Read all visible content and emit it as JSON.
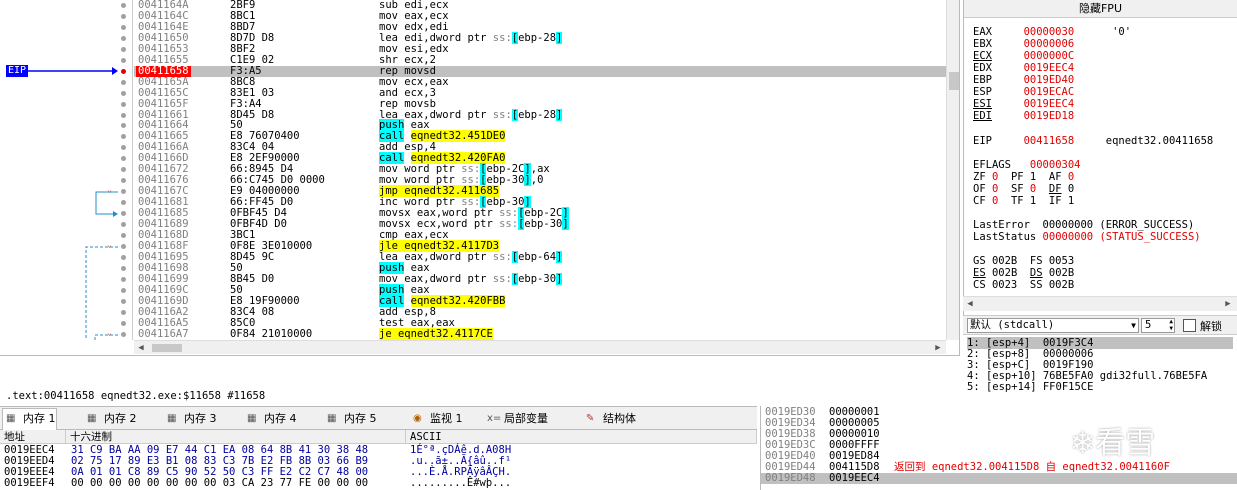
{
  "disasm_rows": [
    {
      "addr": "0041164A",
      "bytes": "2BF9",
      "instr": "sub edi,ecx"
    },
    {
      "addr": "0041164C",
      "bytes": "8BC1",
      "instr": "mov eax,ecx"
    },
    {
      "addr": "0041164E",
      "bytes": "8BD7",
      "instr": "mov edx,edi"
    },
    {
      "addr": "00411650",
      "bytes": "8D7D D8",
      "instr": "lea edi,dword ptr ss:[ebp-28]"
    },
    {
      "addr": "00411653",
      "bytes": "8BF2",
      "instr": "mov esi,edx"
    },
    {
      "addr": "00411655",
      "bytes": "C1E9 02",
      "instr": "shr ecx,2"
    },
    {
      "addr": "00411658",
      "bytes": "F3:A5",
      "instr": "rep movsd"
    },
    {
      "addr": "0041165A",
      "bytes": "8BC8",
      "instr": "mov ecx,eax"
    },
    {
      "addr": "0041165C",
      "bytes": "83E1 03",
      "instr": "and ecx,3"
    },
    {
      "addr": "0041165F",
      "bytes": "F3:A4",
      "instr": "rep movsb"
    },
    {
      "addr": "00411661",
      "bytes": "8D45 D8",
      "instr": "lea eax,dword ptr ss:[ebp-28]"
    },
    {
      "addr": "00411664",
      "bytes": "50",
      "instr": "push eax"
    },
    {
      "addr": "00411665",
      "bytes": "E8 76070400",
      "instr": "call eqnedt32.451DE0"
    },
    {
      "addr": "0041166A",
      "bytes": "83C4 04",
      "instr": "add esp,4"
    },
    {
      "addr": "0041166D",
      "bytes": "E8 2EF90000",
      "instr": "call eqnedt32.420FA0"
    },
    {
      "addr": "00411672",
      "bytes": "66:8945 D4",
      "instr": "mov word ptr ss:[ebp-2C],ax"
    },
    {
      "addr": "00411676",
      "bytes": "66:C745 D0 0000",
      "instr": "mov word ptr ss:[ebp-30],0"
    },
    {
      "addr": "0041167C",
      "bytes": "E9 04000000",
      "instr": "jmp eqnedt32.411685"
    },
    {
      "addr": "00411681",
      "bytes": "66:FF45 D0",
      "instr": "inc word ptr ss:[ebp-30]"
    },
    {
      "addr": "00411685",
      "bytes": "0FBF45 D4",
      "instr": "movsx eax,word ptr ss:[ebp-2C]"
    },
    {
      "addr": "00411689",
      "bytes": "0FBF4D D0",
      "instr": "movsx ecx,word ptr ss:[ebp-30]"
    },
    {
      "addr": "0041168D",
      "bytes": "3BC1",
      "instr": "cmp eax,ecx"
    },
    {
      "addr": "0041168F",
      "bytes": "0F8E 3E010000",
      "instr": "jle eqnedt32.4117D3"
    },
    {
      "addr": "00411695",
      "bytes": "8D45 9C",
      "instr": "lea eax,dword ptr ss:[ebp-64]"
    },
    {
      "addr": "00411698",
      "bytes": "50",
      "instr": "push eax"
    },
    {
      "addr": "00411699",
      "bytes": "8B45 D0",
      "instr": "mov eax,dword ptr ss:[ebp-30]"
    },
    {
      "addr": "0041169C",
      "bytes": "50",
      "instr": "push eax"
    },
    {
      "addr": "0041169D",
      "bytes": "E8 19F90000",
      "instr": "call eqnedt32.420FBB"
    },
    {
      "addr": "004116A2",
      "bytes": "83C4 08",
      "instr": "add esp,8"
    },
    {
      "addr": "004116A5",
      "bytes": "85C0",
      "instr": "test eax,eax"
    },
    {
      "addr": "004116A7",
      "bytes": "0F84 21010000",
      "instr": "je eqnedt32.4117CE"
    }
  ],
  "eip_label": "EIP",
  "info_line": ".text:00411658 eqnedt32.exe:$11658 #11658",
  "registers": {
    "header": "隐藏FPU",
    "gp": [
      {
        "name": "EAX",
        "value": "00000030",
        "extra": "'0'"
      },
      {
        "name": "EBX",
        "value": "00000006",
        "extra": ""
      },
      {
        "name": "ECX",
        "value": "0000000C",
        "extra": ""
      },
      {
        "name": "EDX",
        "value": "0019EEC4",
        "extra": ""
      },
      {
        "name": "EBP",
        "value": "0019ED40",
        "extra": ""
      },
      {
        "name": "ESP",
        "value": "0019ECAC",
        "extra": ""
      },
      {
        "name": "ESI",
        "value": "0019EEC4",
        "extra": ""
      },
      {
        "name": "EDI",
        "value": "0019ED18",
        "extra": ""
      }
    ],
    "eip": {
      "name": "EIP",
      "value": "00411658",
      "extra": "eqnedt32.00411658"
    },
    "eflags": {
      "name": "EFLAGS",
      "value": "00000304"
    },
    "flags_lines": [
      "ZF 0  PF 1  AF 0",
      "OF 0  SF 0  DF 0",
      "CF 0  TF 1  IF 1"
    ],
    "last_error": {
      "label": "LastError",
      "value": "00000000",
      "desc": "(ERROR_SUCCESS)"
    },
    "last_status": {
      "label": "LastStatus",
      "value": "00000000",
      "desc": "(STATUS_SUCCESS)"
    },
    "seg_lines": [
      "GS 002B  FS 0053",
      "ES 002B  DS 002B",
      "CS 0023  SS 002B"
    ]
  },
  "callconv": {
    "selected": "默认 (stdcall)",
    "count": "5",
    "unlock_label": "解锁"
  },
  "stack_args": [
    "1: [esp+4]  0019F3C4",
    "2: [esp+8]  00000006",
    "3: [esp+C]  0019F190",
    "4: [esp+10] 76BE5FA0 gdi32full.76BE5FA",
    "5: [esp+14] FF0F15CE"
  ],
  "tabs": [
    {
      "label": "内存 1",
      "icon": "memory-icon"
    },
    {
      "label": "内存 2",
      "icon": "memory-icon"
    },
    {
      "label": "内存 3",
      "icon": "memory-icon"
    },
    {
      "label": "内存 4",
      "icon": "memory-icon"
    },
    {
      "label": "内存 5",
      "icon": "memory-icon"
    },
    {
      "label": "监视 1",
      "icon": "watch-icon"
    },
    {
      "label": "局部变量",
      "icon": "locals-icon"
    },
    {
      "label": "结构体",
      "icon": "struct-icon"
    }
  ],
  "dump": {
    "col_addr": "地址",
    "col_hex": "十六进制",
    "col_ascii": "ASCII",
    "rows": [
      {
        "addr": "0019EEC4",
        "hex": "31 C9 BA AA 09 E7 44 C1 EA 08 64 8B 41 30 38 48",
        "ascii": "1É°ª.çDÁê.d.A08H"
      },
      {
        "addr": "0019EED4",
        "hex": "02 75 17 89 E3 B1 08 83 C3 7B E2 FB 8B 03 66 B9",
        "ascii": ".u..ã±..Ã{âû..f¹"
      },
      {
        "addr": "0019EEE4",
        "hex": "0A 01 01 C8 89 C5 90 52 50 C3 FF E2 C2 C7 48 00",
        "ascii": "...È.Å.RPÃÿâÂÇH."
      },
      {
        "addr": "0019EEF4",
        "hex": "00 00 00 00 00 00 00 00 03 CA 23 77 FE 00 00 00",
        "ascii": ".........Ê#wþ..."
      }
    ]
  },
  "stack_rows": [
    {
      "addr": "0019ED30",
      "val": "00000001",
      "comment": ""
    },
    {
      "addr": "0019ED34",
      "val": "00000005",
      "comment": ""
    },
    {
      "addr": "0019ED38",
      "val": "00000010",
      "comment": ""
    },
    {
      "addr": "0019ED3C",
      "val": "0000FFFF",
      "comment": ""
    },
    {
      "addr": "0019ED40",
      "val": "0019ED84",
      "comment": ""
    },
    {
      "addr": "0019ED44",
      "val": "004115D8",
      "comment": "返回到 eqnedt32.004115D8 自 eqnedt32.0041160F"
    },
    {
      "addr": "0019ED48",
      "val": "0019EEC4",
      "comment": ""
    }
  ],
  "watermark": "看雪"
}
